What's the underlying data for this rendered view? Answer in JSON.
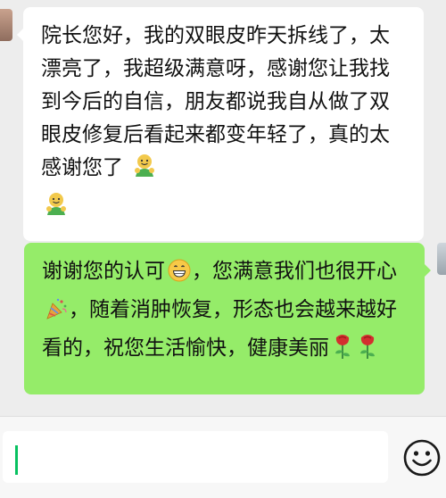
{
  "conversation": {
    "incoming": {
      "text": "院长您好，我的双眼皮昨天拆线了，太漂亮了，我超级满意呀，感谢您让我找到今后的自信，朋友都说我自从做了双眼皮修复后看起来都变年轻了，真的太感谢您了",
      "trailing_emojis": [
        "smiling-figure-emoji",
        "smiling-figure-emoji"
      ]
    },
    "outgoing": {
      "text_1": "谢谢您的认可",
      "emoji_1": "grin-emoji",
      "text_2": "，您满意我们也很开心",
      "emoji_2": "party-popper-emoji",
      "text_3": "，随着消肿恢复，形态也会越来越好看的，祝您生活愉快，健康美丽",
      "trailing_emojis": [
        "rose-emoji",
        "rose-emoji"
      ]
    }
  },
  "input_bar": {
    "value": "",
    "emoji_button_icon": "smiley-face-icon"
  },
  "colors": {
    "incoming_bubble": "#ffffff",
    "outgoing_bubble": "#95ec69",
    "background": "#ededed",
    "caret": "#07c160"
  }
}
